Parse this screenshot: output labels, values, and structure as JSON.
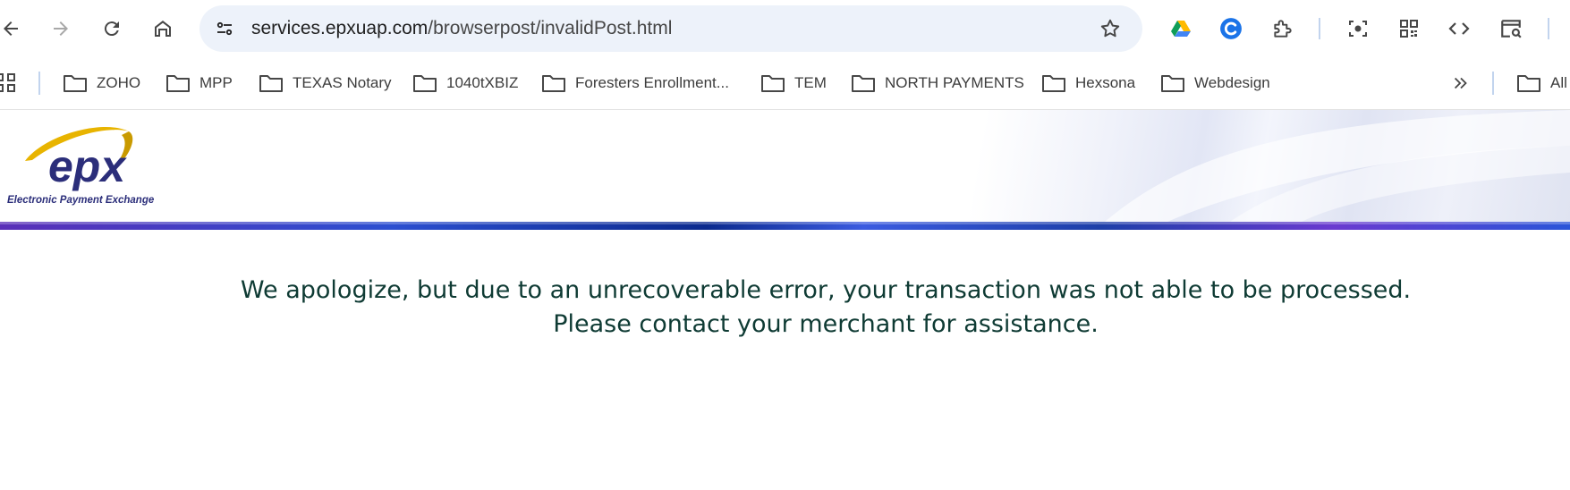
{
  "toolbar": {
    "url_host": "services.epxuap.com",
    "url_path": "/browserpost/invalidPost.html"
  },
  "bookmarks": [
    {
      "label": "ZOHO"
    },
    {
      "label": "MPP"
    },
    {
      "label": "TEXAS Notary"
    },
    {
      "label": "1040tXBIZ"
    },
    {
      "label": "Foresters Enrollment..."
    },
    {
      "label": "TEM"
    },
    {
      "label": "NORTH PAYMENTS"
    },
    {
      "label": "Hexsona"
    },
    {
      "label": "Webdesign"
    }
  ],
  "bookmarks_overflow": {
    "label": "All"
  },
  "logo": {
    "wordmark": "epx",
    "caption": "Electronic Payment Exchange"
  },
  "message": {
    "line1": "We apologize, but due to an unrecoverable error, your transaction was not able to be processed.",
    "line2": "Please contact your merchant for assistance."
  },
  "colors": {
    "message_text": "#0f3b34",
    "stripe_blue": "#0b2a8e",
    "logo_navy": "#2b2e7a",
    "logo_gold": "#e8b400"
  },
  "icons": {
    "toolbar": [
      "back-icon",
      "forward-icon",
      "reload-icon",
      "home-icon",
      "site-info-icon",
      "bookmark-star-icon"
    ],
    "extensions": [
      "google-drive-icon",
      "grammar-extension-icon",
      "extensions-puzzle-icon",
      "screenshot-icon",
      "qr-code-icon",
      "code-icon",
      "tab-search-icon"
    ]
  }
}
